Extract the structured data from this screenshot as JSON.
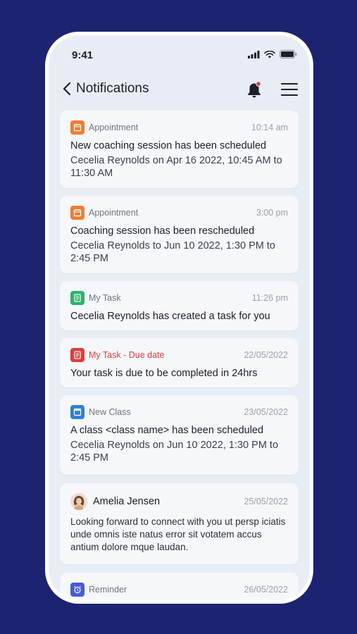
{
  "status_bar": {
    "time": "9:41"
  },
  "header": {
    "title": "Notifications"
  },
  "notifications": [
    {
      "category": "Appointment",
      "time": "10:14 am",
      "title": "New coaching session has been scheduled",
      "body": "Cecelia Reynolds on Apr 16 2022, 10:45 AM to 11:30 AM",
      "icon": "calendar-icon",
      "color": "#f07c30"
    },
    {
      "category": "Appointment",
      "time": "3:00 pm",
      "title": "Coaching session has been rescheduled",
      "body": "Cecelia Reynolds to Jun 10 2022, 1:30 PM to 2:45 PM",
      "icon": "calendar-icon",
      "color": "#f07c30"
    },
    {
      "category": "My Task",
      "time": "11:26 pm",
      "title": "Cecelia Reynolds has created  a task for you",
      "icon": "task-icon",
      "color": "#2fb36b"
    },
    {
      "category": "My Task - Due date",
      "time": "22/05/2022",
      "title": "Your task is due to be completed in 24hrs",
      "icon": "task-icon",
      "color": "#e23b3b"
    },
    {
      "category": "New Class",
      "time": "23/05/2022",
      "title": "A class <class name> has been scheduled",
      "body": "Cecelia Reynolds on Jun 10 2022, 1:30 PM to 2:45 PM",
      "icon": "class-icon",
      "color": "#2f7fd8"
    },
    {
      "sender": "Amelia Jensen",
      "time": "25/05/2022",
      "body": "Looking forward to connect with you ut persp iciatis unde omnis iste natus error sit votatem accus antium dolore mque laudan."
    },
    {
      "category": "Reminder",
      "time": "26/05/2022",
      "icon": "alarm-clock-icon",
      "color": "#4a5bd4"
    }
  ]
}
